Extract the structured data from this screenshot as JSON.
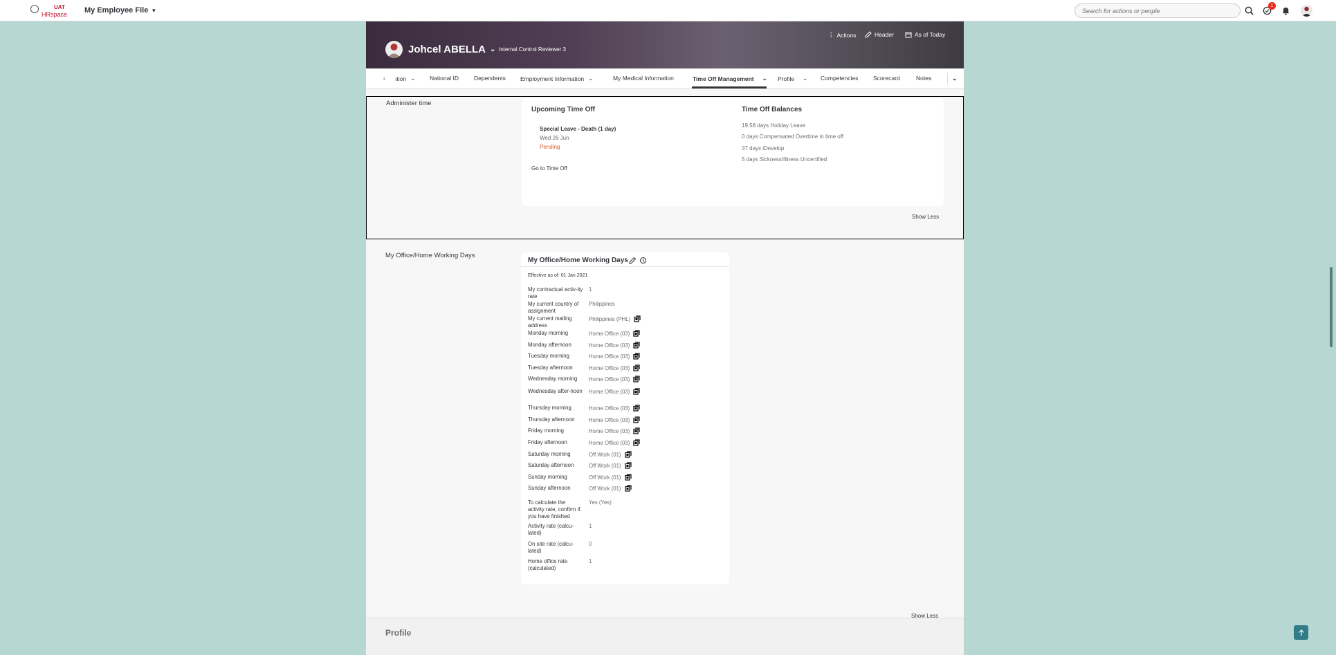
{
  "shell": {
    "logo_top": "UAT",
    "logo_bottom": "HRspace",
    "app_title": "My Employee File",
    "search_placeholder": "Search for actions or people",
    "notification_count": "1"
  },
  "header": {
    "name": "Johcel ABELLA",
    "role": "Internal Control Reviewer 3",
    "actions": [
      "Actions",
      "Header",
      "As of Today"
    ]
  },
  "tabs": [
    {
      "label": "ıtion"
    },
    {
      "label": "National ID"
    },
    {
      "label": "Dependents"
    },
    {
      "label": "Employment Information"
    },
    {
      "label": "My Medical Information"
    },
    {
      "label": "Time Off Management"
    },
    {
      "label": "Profile"
    },
    {
      "label": "Competencies"
    },
    {
      "label": "Scorecard"
    },
    {
      "label": "Notes"
    }
  ],
  "admin": {
    "section_label": "Administer time",
    "upcoming_title": "Upcoming Time Off",
    "leave_title": "Special Leave - Death (1 day)",
    "leave_date": "Wed 26 Jun",
    "leave_status": "Pending",
    "go_to_link": "Go to Time Off",
    "balances_title": "Time Off Balances",
    "balances": [
      "19.58 days Holiday Leave",
      "0 days Compensated Overtime in time off",
      "37 days iDevelop",
      "5 days Sickness/Illness Uncertified"
    ],
    "show_less": "Show Less"
  },
  "office": {
    "section_label": "My Office/Home Working Days",
    "card_title": "My Office/Home Working Days",
    "effective": "Effective as of: 01 Jan 2021",
    "rows": [
      {
        "label": "My contractual activ-ity rate",
        "value": "1"
      },
      {
        "label": "My current country of assignment",
        "value": "Philippines"
      },
      {
        "label": "My current mailing address",
        "value": "Philippines (PHL)"
      },
      {
        "label": "Monday morning",
        "value": "Home Office (03)"
      },
      {
        "label": "Monday afternoon",
        "value": "Home Office (03)"
      },
      {
        "label": "Tuesday morning",
        "value": "Home Office (03)"
      },
      {
        "label": "Tuesday afternoon",
        "value": "Home Office (03)"
      },
      {
        "label": "Wednesday morning",
        "value": "Home Office (03)"
      },
      {
        "label": "Wednesday after-noon",
        "value": "Home Office (03)"
      },
      {
        "label": "Thursday morning",
        "value": "Home Office (03)"
      },
      {
        "label": "Thursday afternoon",
        "value": "Home Office (03)"
      },
      {
        "label": "Friday morning",
        "value": "Home Office (03)"
      },
      {
        "label": "Friday afternoon",
        "value": "Home Office (03)"
      },
      {
        "label": "Saturday morning",
        "value": "Off Work (01)"
      },
      {
        "label": "Saturday afternoon",
        "value": "Off Work (01)"
      },
      {
        "label": "Sunday morning",
        "value": "Off Work (01)"
      },
      {
        "label": "Sunday afternoon",
        "value": "Off Work (01)"
      },
      {
        "label": "To calculate the activity rate, confirm if you have finished",
        "value": "Yes (Yes)"
      },
      {
        "label": "Activity rate (calcu-lated)",
        "value": "1"
      },
      {
        "label": "On site rate (calcu-lated)",
        "value": "0"
      },
      {
        "label": "Home office rate (calculated)",
        "value": "1"
      }
    ],
    "show_less": "Show Less"
  },
  "profile": {
    "title": "Profile"
  }
}
